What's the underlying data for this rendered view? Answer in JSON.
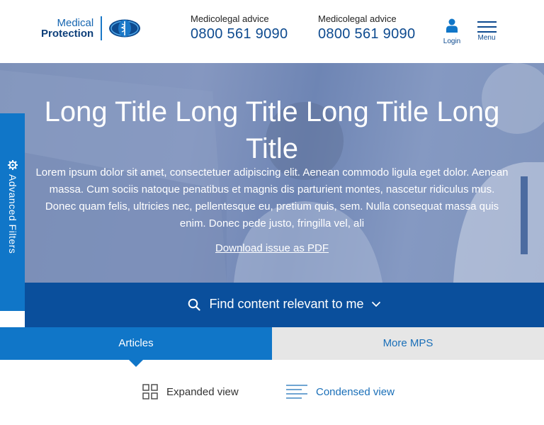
{
  "header": {
    "logo": {
      "line1": "Medical",
      "line2": "Protection"
    },
    "contacts": [
      {
        "label": "Medicolegal advice",
        "number": "0800 561 9090"
      },
      {
        "label": "Medicolegal advice",
        "number": "0800 561 9090"
      }
    ],
    "login_label": "Login",
    "menu_label": "Menu"
  },
  "hero": {
    "title": "Long Title Long Title Long Title Long Title",
    "body": "Lorem ipsum dolor sit amet, consectetuer adipiscing elit. Aenean commodo ligula eget dolor. Aenean massa. Cum sociis natoque penatibus et magnis dis parturient montes, nascetur ridiculus mus. Donec quam felis, ultricies nec, pellentesque eu, pretium quis, sem. Nulla consequat massa quis enim. Donec pede justo, fringilla vel, ali",
    "download_link": "Download issue as PDF"
  },
  "side_tab": {
    "label": "Advanced Filters",
    "icon": "gear-icon"
  },
  "find_bar": {
    "label": "Find content relevant to me",
    "icon": "search-icon",
    "chevron": "chevron-down-icon"
  },
  "tabs": [
    {
      "label": "Articles",
      "active": true
    },
    {
      "label": "More MPS",
      "active": false
    }
  ],
  "views": {
    "expanded": {
      "label": "Expanded view",
      "icon": "grid-icon"
    },
    "condensed": {
      "label": "Condensed view",
      "icon": "list-icon"
    }
  },
  "colors": {
    "brand_dark": "#0d4a8f",
    "brand_blue": "#1076c8",
    "find_bar": "#0a4f9c",
    "tab_inactive": "#e6e6e6"
  }
}
